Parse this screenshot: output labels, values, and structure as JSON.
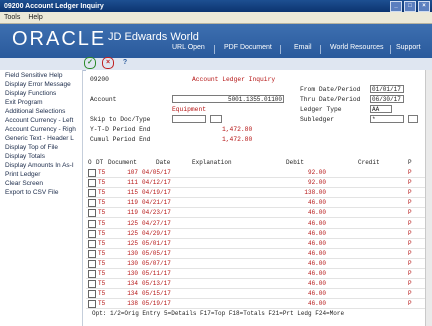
{
  "window": {
    "title": "09200     Account Ledger Inquiry"
  },
  "menubar": {
    "items": [
      "Tools",
      "Help"
    ]
  },
  "banner": {
    "logo": "ORACLE",
    "product": "JD Edwards World",
    "links": [
      "URL Open",
      "PDF Document",
      "Email",
      "World Resources",
      "Support"
    ]
  },
  "sidebar": {
    "items": [
      "Field Sensitive Help",
      "Display Error Message",
      "Display Functions",
      "Exit Program",
      "Additional Selections",
      "Account Currency - Left",
      "Account Currency - Righ",
      "Generic Text - Header L",
      "Display Top of File",
      "Display Totals",
      "Display Amounts In As-I",
      "Print Ledger",
      "Clear Screen",
      "Export to CSV File"
    ]
  },
  "form": {
    "program_id": "09200",
    "title": "Account Ledger Inquiry",
    "account_label": "Account",
    "account_value": "5001.1355.01100",
    "account_desc": "Equipment",
    "skip_label": "Skip to Doc/Type",
    "ytd_label": "Y-T-D Period End",
    "ytd_value": "1,472.80",
    "cumul_label": "Cumul Period End",
    "cumul_value": "1,472.80",
    "from_label": "From Date/Period",
    "from_value": "01/01/17",
    "thru_label": "Thru Date/Period",
    "thru_value": "06/30/17",
    "ledger_type_label": "Ledger Type",
    "ledger_type_value": "AA",
    "subledger_label": "Subledger",
    "subledger_value": "*"
  },
  "grid": {
    "headers": {
      "o": "O",
      "dt": "DT",
      "document": "Document",
      "date": "Date",
      "explanation": "Explanation",
      "debit": "Debit",
      "credit": "Credit",
      "p": "P"
    },
    "rows": [
      {
        "dt": "T5",
        "doc": "107",
        "date": "04/05/17",
        "debit": "92.00",
        "p": "P"
      },
      {
        "dt": "T5",
        "doc": "111",
        "date": "04/12/17",
        "debit": "92.00",
        "p": "P"
      },
      {
        "dt": "T5",
        "doc": "115",
        "date": "04/19/17",
        "debit": "138.00",
        "p": "P"
      },
      {
        "dt": "T5",
        "doc": "119",
        "date": "04/21/17",
        "debit": "46.00",
        "p": "P"
      },
      {
        "dt": "T5",
        "doc": "119",
        "date": "04/23/17",
        "debit": "46.00",
        "p": "P"
      },
      {
        "dt": "T5",
        "doc": "125",
        "date": "04/27/17",
        "debit": "46.00",
        "p": "P"
      },
      {
        "dt": "T5",
        "doc": "125",
        "date": "04/29/17",
        "debit": "46.00",
        "p": "P"
      },
      {
        "dt": "T5",
        "doc": "125",
        "date": "05/01/17",
        "debit": "46.00",
        "p": "P"
      },
      {
        "dt": "T5",
        "doc": "130",
        "date": "05/05/17",
        "debit": "46.00",
        "p": "P"
      },
      {
        "dt": "T5",
        "doc": "130",
        "date": "05/07/17",
        "debit": "46.00",
        "p": "P"
      },
      {
        "dt": "T5",
        "doc": "130",
        "date": "05/11/17",
        "debit": "46.00",
        "p": "P"
      },
      {
        "dt": "T5",
        "doc": "134",
        "date": "05/13/17",
        "debit": "46.00",
        "p": "P"
      },
      {
        "dt": "T5",
        "doc": "134",
        "date": "05/15/17",
        "debit": "46.00",
        "p": "P"
      },
      {
        "dt": "T5",
        "doc": "138",
        "date": "05/19/17",
        "debit": "46.00",
        "p": "P"
      }
    ]
  },
  "footer": {
    "options": "Opt: 1/2=Orig Entry  5=Details  F17=Top  F18=Totals  F21=Prt Ledg  F24=More"
  },
  "colors": {
    "banner": "#2a5a9c",
    "accent_red": "#b51414",
    "titlebar": "#0c3470"
  }
}
